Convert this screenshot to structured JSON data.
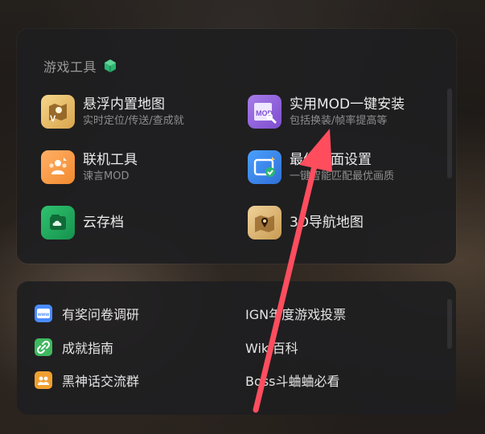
{
  "panel": {
    "title": "游戏工具",
    "tools": [
      {
        "name": "悬浮内置地图",
        "desc": "实时定位/传送/查成就",
        "icon": "floating-map-icon"
      },
      {
        "name": "实用MOD一键安装",
        "desc": "包括换装/帧率提高等",
        "icon": "mod-install-icon"
      },
      {
        "name": "联机工具",
        "desc": "谏言MOD",
        "icon": "multiplayer-tool-icon"
      },
      {
        "name": "最佳画面设置",
        "desc": "一键智能匹配最优画质",
        "icon": "graphics-settings-icon"
      },
      {
        "name": "云存档",
        "desc": "",
        "icon": "cloud-save-icon"
      },
      {
        "name": "3D导航地图",
        "desc": "",
        "icon": "3d-nav-map-icon"
      }
    ]
  },
  "links": {
    "left": [
      {
        "label": "有奖问卷调研",
        "icon": "survey-icon",
        "color": "#4a8cff"
      },
      {
        "label": "成就指南",
        "icon": "link-icon",
        "color": "#3fb860"
      },
      {
        "label": "黑神话交流群",
        "icon": "group-icon",
        "color": "#f0a030"
      }
    ],
    "right": [
      {
        "label": "IGN年度游戏投票"
      },
      {
        "label": "Wiki百科"
      },
      {
        "label": "Boss斗蛐蛐必看"
      }
    ]
  },
  "colors": {
    "arrow": "#ff4d5e",
    "panel_bg": "#1e1e20"
  }
}
